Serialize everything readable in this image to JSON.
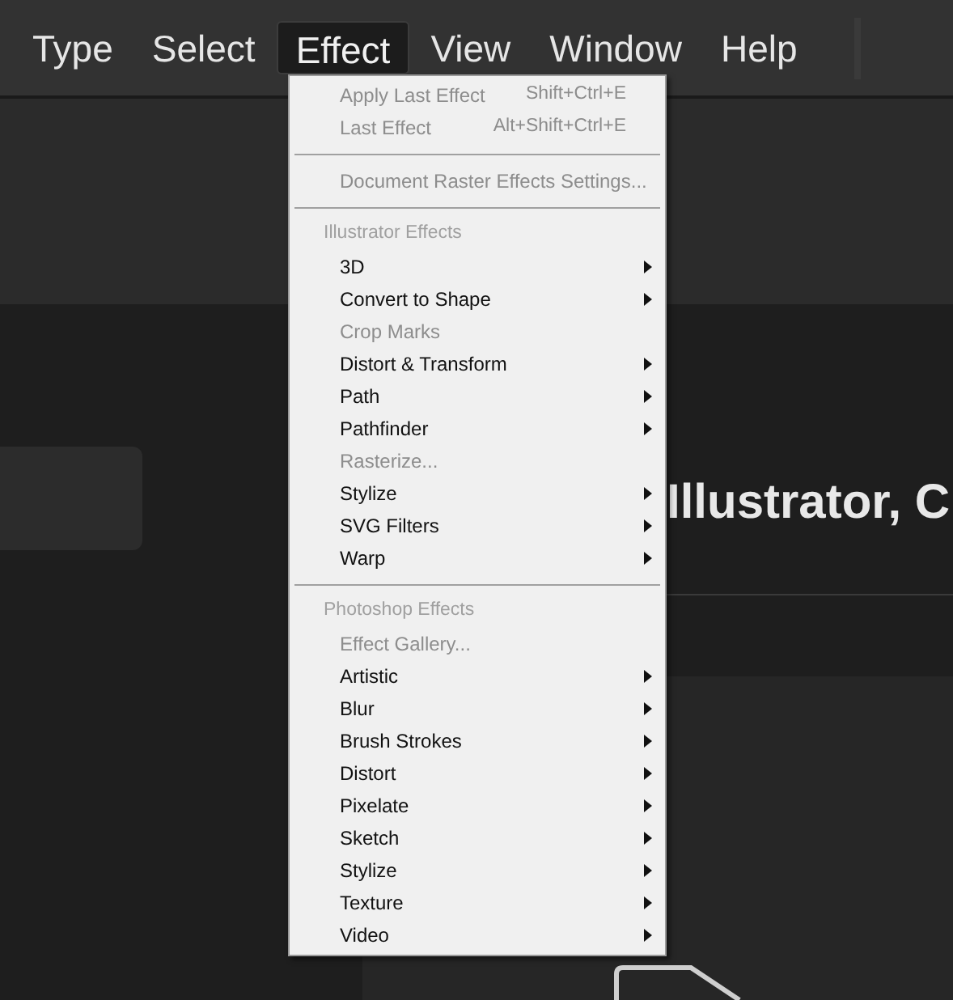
{
  "menubar": [
    {
      "label": "Type",
      "selected": false
    },
    {
      "label": "Select",
      "selected": false
    },
    {
      "label": "Effect",
      "selected": true
    },
    {
      "label": "View",
      "selected": false
    },
    {
      "label": "Window",
      "selected": false
    },
    {
      "label": "Help",
      "selected": false
    }
  ],
  "heading": "Illustrator, C",
  "menu": [
    {
      "kind": "item",
      "label": "Apply Last Effect",
      "shortcut": "Shift+Ctrl+E",
      "disabled": true,
      "submenu": false
    },
    {
      "kind": "item",
      "label": "Last Effect",
      "shortcut": "Alt+Shift+Ctrl+E",
      "disabled": true,
      "submenu": false
    },
    {
      "kind": "separator"
    },
    {
      "kind": "item",
      "label": "Document Raster Effects Settings...",
      "disabled": true,
      "submenu": false
    },
    {
      "kind": "separator"
    },
    {
      "kind": "header",
      "label": "Illustrator Effects"
    },
    {
      "kind": "item",
      "label": "3D",
      "disabled": false,
      "submenu": true
    },
    {
      "kind": "item",
      "label": "Convert to Shape",
      "disabled": false,
      "submenu": true
    },
    {
      "kind": "item",
      "label": "Crop Marks",
      "disabled": true,
      "submenu": false
    },
    {
      "kind": "item",
      "label": "Distort & Transform",
      "disabled": false,
      "submenu": true
    },
    {
      "kind": "item",
      "label": "Path",
      "disabled": false,
      "submenu": true
    },
    {
      "kind": "item",
      "label": "Pathfinder",
      "disabled": false,
      "submenu": true
    },
    {
      "kind": "item",
      "label": "Rasterize...",
      "disabled": true,
      "submenu": false
    },
    {
      "kind": "item",
      "label": "Stylize",
      "disabled": false,
      "submenu": true
    },
    {
      "kind": "item",
      "label": "SVG Filters",
      "disabled": false,
      "submenu": true
    },
    {
      "kind": "item",
      "label": "Warp",
      "disabled": false,
      "submenu": true
    },
    {
      "kind": "separator"
    },
    {
      "kind": "header",
      "label": "Photoshop Effects"
    },
    {
      "kind": "item",
      "label": "Effect Gallery...",
      "disabled": true,
      "submenu": false
    },
    {
      "kind": "item",
      "label": "Artistic",
      "disabled": false,
      "submenu": true
    },
    {
      "kind": "item",
      "label": "Blur",
      "disabled": false,
      "submenu": true
    },
    {
      "kind": "item",
      "label": "Brush Strokes",
      "disabled": false,
      "submenu": true
    },
    {
      "kind": "item",
      "label": "Distort",
      "disabled": false,
      "submenu": true
    },
    {
      "kind": "item",
      "label": "Pixelate",
      "disabled": false,
      "submenu": true
    },
    {
      "kind": "item",
      "label": "Sketch",
      "disabled": false,
      "submenu": true
    },
    {
      "kind": "item",
      "label": "Stylize",
      "disabled": false,
      "submenu": true
    },
    {
      "kind": "item",
      "label": "Texture",
      "disabled": false,
      "submenu": true
    },
    {
      "kind": "item",
      "label": "Video",
      "disabled": false,
      "submenu": true
    }
  ]
}
